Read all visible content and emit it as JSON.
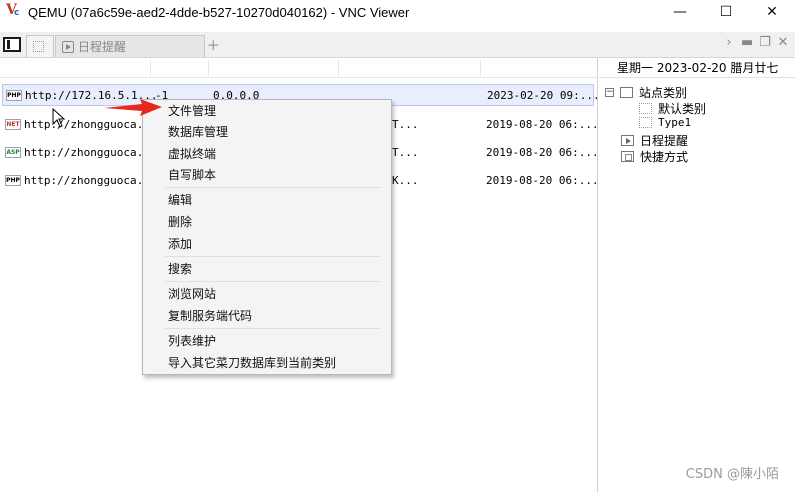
{
  "window": {
    "title": "QEMU (07a6c59e-aed2-4dde-b527-10270d040162) - VNC Viewer",
    "minimize": "—",
    "maximize": "☐",
    "close": "✕",
    "icon": "vnc-viewer-icon"
  },
  "tabs": {
    "items": [
      {
        "label": ""
      },
      {
        "label": "日程提醒"
      }
    ],
    "add": "+",
    "right": {
      "chevron": "›",
      "minimize": "▬",
      "restore": "❐",
      "close": "✕"
    }
  },
  "list": {
    "rows": [
      {
        "badge": "PHP",
        "url": "http://172.16.5.1...",
        "c2": "-1",
        "c3": "0.0.0.0",
        "c4": "",
        "date": "2023-02-20 09:...",
        "selected": true
      },
      {
        "badge": "NET",
        "url": "http://zhongguoca...",
        "c2": "",
        "c3": "",
        "c4": "T...",
        "date": "2019-08-20 06:...",
        "selected": false
      },
      {
        "badge": "ASP",
        "url": "http://zhongguoca...",
        "c2": "",
        "c3": "",
        "c4": "T...",
        "date": "2019-08-20 06:...",
        "selected": false
      },
      {
        "badge": "PHP",
        "url": "http://zhongguoca...",
        "c2": "",
        "c3": "",
        "c4": "K...",
        "date": "2019-08-20 06:...",
        "selected": false
      }
    ]
  },
  "right_panel": {
    "date": "星期一  2023-02-20  腊月廿七",
    "tree": {
      "root": {
        "expander": "−",
        "label": "站点类别"
      },
      "children": [
        "默认类别",
        "Type1"
      ],
      "schedule": "日程提醒",
      "shortcuts": "快捷方式"
    }
  },
  "context_menu": {
    "items": [
      "文件管理",
      "数据库管理",
      "虚拟终端",
      "自写脚本",
      "编辑",
      "删除",
      "添加",
      "搜索",
      "浏览网站",
      "复制服务端代码",
      "列表维护",
      "导入其它菜刀数据库到当前类别"
    ]
  },
  "annotation": {
    "arrow_color": "#e8281e"
  },
  "watermark": "CSDN @陳小陌"
}
